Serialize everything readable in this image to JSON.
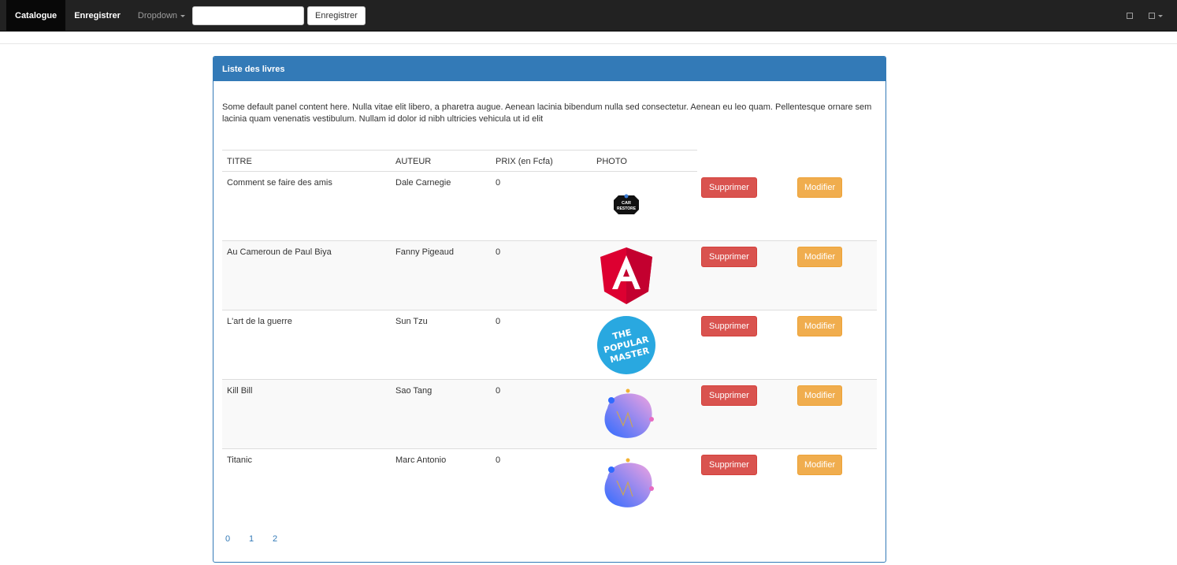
{
  "navbar": {
    "items": [
      {
        "label": "Catalogue"
      },
      {
        "label": "Enregistrer"
      },
      {
        "label": "Dropdown"
      }
    ],
    "search": {
      "value": "",
      "placeholder": ""
    },
    "submit_label": "Enregistrer",
    "right_icons": [
      "user-icon",
      "settings-icon"
    ]
  },
  "panel": {
    "title": "Liste des livres",
    "body": "Some default panel content here. Nulla vitae elit libero, a pharetra augue. Aenean lacinia bibendum nulla sed consectetur. Aenean eu leo quam. Pellentesque ornare sem lacinia quam venenatis vestibulum. Nullam id dolor id nibh ultricies vehicula ut id elit"
  },
  "table": {
    "headers": [
      "TITRE",
      "AUTEUR",
      "PRIX (en Fcfa)",
      "PHOTO"
    ],
    "rows": [
      {
        "titre": "Comment se faire des amis",
        "auteur": "Dale Carnegie",
        "prix": "0",
        "photo": "car-restore-logo",
        "logo_text": [
          "CAR",
          "RESTORE"
        ]
      },
      {
        "titre": "Au Cameroun de Paul Biya",
        "auteur": "Fanny Pigeaud",
        "prix": "0",
        "photo": "angular-logo"
      },
      {
        "titre": "L'art de la guerre",
        "auteur": "Sun Tzu",
        "prix": "0",
        "photo": "popular-master-logo",
        "logo_text": [
          "THE",
          "POPULAR",
          "MASTER"
        ]
      },
      {
        "titre": "Kill Bill",
        "auteur": "Sao Tang",
        "prix": "0",
        "photo": "gradient-blob-logo"
      },
      {
        "titre": "Titanic",
        "auteur": "Marc Antonio",
        "prix": "0",
        "photo": "gradient-blob-logo"
      }
    ],
    "delete_label": "Supprimer",
    "edit_label": "Modifier"
  },
  "pagination": [
    "0",
    "1",
    "2"
  ],
  "colors": {
    "navbar_bg": "#222222",
    "primary": "#337ab7",
    "danger": "#d9534f",
    "warning": "#f0ad4e"
  }
}
